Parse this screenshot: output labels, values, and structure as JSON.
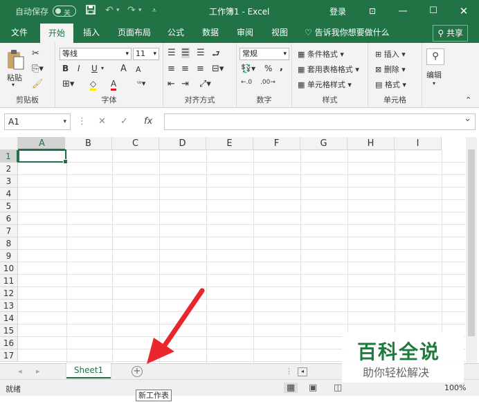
{
  "titlebar": {
    "autosave_label": "自动保存",
    "autosave_state": "关",
    "title": "工作簿1  -  Excel",
    "signin": "登录"
  },
  "tabs": [
    "文件",
    "开始",
    "插入",
    "页面布局",
    "公式",
    "数据",
    "审阅",
    "视图"
  ],
  "active_tab": "开始",
  "tell_me": "告诉我你想要做什么",
  "share_label": "共享",
  "ribbon": {
    "clipboard": {
      "paste": "粘贴",
      "label": "剪贴板"
    },
    "font": {
      "name": "等线",
      "size": "11",
      "label": "字体",
      "bold": "B",
      "italic": "I",
      "underline": "U",
      "grow": "A",
      "shrink": "A",
      "color": "A"
    },
    "alignment": {
      "label": "对齐方式"
    },
    "number": {
      "format": "常规",
      "label": "数字",
      "percent": "%",
      "comma": ","
    },
    "styles": {
      "conditional": "条件格式",
      "table": "套用表格格式",
      "cell": "单元格样式",
      "label": "样式"
    },
    "cells": {
      "insert": "插入",
      "delete": "删除",
      "format": "格式",
      "label": "单元格"
    },
    "editing": {
      "label": "编辑"
    }
  },
  "formula_bar": {
    "name_box": "A1",
    "cancel": "✕",
    "enter": "✓",
    "fx": "fx",
    "value": ""
  },
  "grid": {
    "columns": [
      "A",
      "B",
      "C",
      "D",
      "E",
      "F",
      "G",
      "H",
      "I"
    ],
    "rows": [
      "1",
      "2",
      "3",
      "4",
      "5",
      "6",
      "7",
      "8",
      "9",
      "10",
      "11",
      "12",
      "13",
      "14",
      "15",
      "16",
      "17"
    ],
    "active_cell": "A1"
  },
  "sheets": [
    "Sheet1"
  ],
  "status": {
    "ready": "就绪",
    "zoom": "100%"
  },
  "tooltip": "新工作表",
  "watermark": {
    "line1": "百科全说",
    "line2": "助你轻松解决"
  },
  "colors": {
    "accent": "#217346",
    "arrow": "#e8262b"
  }
}
